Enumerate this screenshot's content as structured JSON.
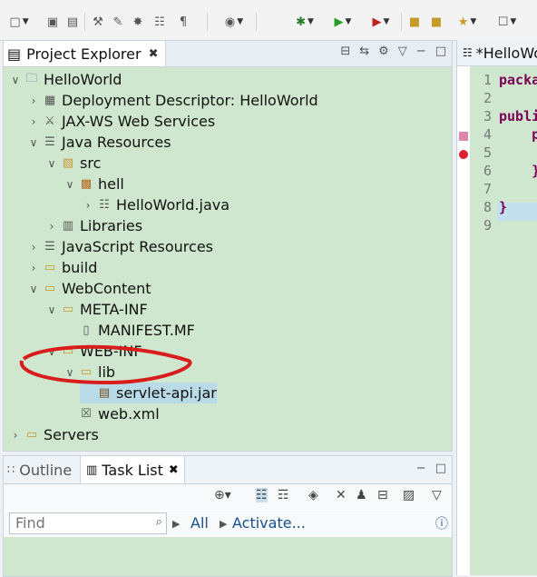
{
  "toolbar": {
    "icons": [
      "new-icon",
      "save-icon",
      "save-all-icon",
      "build-icon",
      "pen-icon",
      "wand-icon",
      "doc-icon",
      "pilcrow-icon",
      "profile-icon",
      "debug-icon",
      "run-icon",
      "run-config-icon",
      "open-folder-icon",
      "folder-icon",
      "pin-icon",
      "search-icon"
    ]
  },
  "project_explorer": {
    "tab_label": "Project Explorer",
    "tree": [
      {
        "label": "HelloWorld",
        "depth": 0,
        "twisty": "open",
        "icon": "project"
      },
      {
        "label": "Deployment Descriptor: HelloWorld",
        "depth": 1,
        "twisty": "closed",
        "icon": "descriptor"
      },
      {
        "label": "JAX-WS Web Services",
        "depth": 1,
        "twisty": "closed",
        "icon": "webservice"
      },
      {
        "label": "Java Resources",
        "depth": 1,
        "twisty": "open",
        "icon": "javares"
      },
      {
        "label": "src",
        "depth": 2,
        "twisty": "open",
        "icon": "srcfolder"
      },
      {
        "label": "hell",
        "depth": 3,
        "twisty": "open",
        "icon": "package"
      },
      {
        "label": "HelloWorld.java",
        "depth": 4,
        "twisty": "closed",
        "icon": "javafile"
      },
      {
        "label": "Libraries",
        "depth": 2,
        "twisty": "closed",
        "icon": "library"
      },
      {
        "label": "JavaScript Resources",
        "depth": 1,
        "twisty": "closed",
        "icon": "jsres"
      },
      {
        "label": "build",
        "depth": 1,
        "twisty": "closed",
        "icon": "folder"
      },
      {
        "label": "WebContent",
        "depth": 1,
        "twisty": "open",
        "icon": "folder"
      },
      {
        "label": "META-INF",
        "depth": 2,
        "twisty": "open",
        "icon": "folder"
      },
      {
        "label": "MANIFEST.MF",
        "depth": 3,
        "twisty": "none",
        "icon": "file"
      },
      {
        "label": "WEB-INF",
        "depth": 2,
        "twisty": "open",
        "icon": "folder"
      },
      {
        "label": "lib",
        "depth": 3,
        "twisty": "open",
        "icon": "folder"
      },
      {
        "label": "servlet-api.jar",
        "depth": 4,
        "twisty": "none",
        "icon": "jar",
        "selected": true
      },
      {
        "label": "web.xml",
        "depth": 3,
        "twisty": "none",
        "icon": "xml"
      },
      {
        "label": "Servers",
        "depth": 0,
        "twisty": "closed",
        "icon": "folder"
      }
    ]
  },
  "bottom_panel": {
    "tab_outline": "Outline",
    "tab_tasklist": "Task List",
    "find_placeholder": "Find",
    "filter_all": "All",
    "filter_activate": "Activate..."
  },
  "editor": {
    "tab_label": "*HelloWorld.java",
    "line_numbers": [
      "1",
      "2",
      "3",
      "4",
      "5",
      "6",
      "7",
      "8",
      "9"
    ],
    "code_lines": [
      "packa",
      "",
      "publi",
      "    p",
      "",
      "    }",
      "",
      "}",
      ""
    ]
  },
  "colors": {
    "tree_bg": "#cfe7cf",
    "selection": "#b9dbe8",
    "annotation": "#d91c1c"
  }
}
